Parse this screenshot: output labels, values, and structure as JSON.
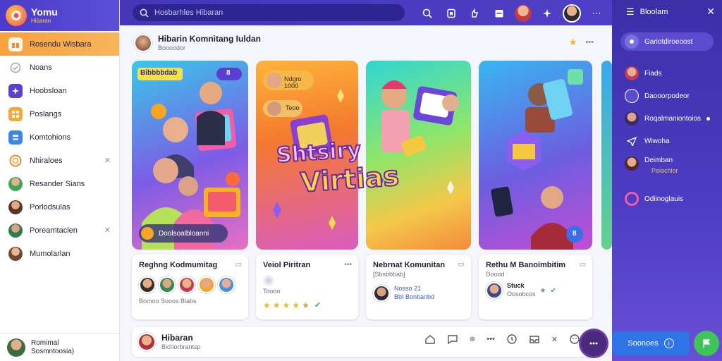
{
  "brand": {
    "name": "Yomu",
    "sub": "Hibaran"
  },
  "sidebar": {
    "items": [
      {
        "label": "Rosendu Wisbara",
        "icon": "gift-icon",
        "color": "#f6a23e",
        "active": true
      },
      {
        "label": "Noans",
        "icon": "check-circle-icon",
        "color": "#9aa0b3"
      },
      {
        "label": "Hoobsloan",
        "icon": "sparkle-icon",
        "color": "#5b3fd8"
      },
      {
        "label": "Poslangs",
        "icon": "grid-icon",
        "color": "#f7a63a"
      },
      {
        "label": "Komtohions",
        "icon": "layers-icon",
        "color": "#3a86ef"
      },
      {
        "label": "Nhiraloes",
        "icon": "swirl-icon",
        "color": "#f08a2e",
        "closable": true
      },
      {
        "label": "Resander Sians",
        "icon": "avatar-icon",
        "color": "#3aa858"
      },
      {
        "label": "Porlodsulas",
        "icon": "avatar-icon",
        "color": "#b0654a"
      },
      {
        "label": "Poreamtaclen",
        "icon": "avatar-icon",
        "color": "#3a9a6a",
        "closable": true
      },
      {
        "label": "Mumolarlan",
        "icon": "avatar-icon",
        "color": "#b68a62"
      }
    ],
    "footer": {
      "name": "Romimal",
      "sub": "Sosmntoosia)"
    }
  },
  "topbar": {
    "search_placeholder": "Hosbarhles Hibaran"
  },
  "header": {
    "title": "Hibarin Komnitang Iuldan",
    "subtitle": "Boooodor"
  },
  "banners": [
    {
      "badge": "Bibbbbdab",
      "count": "8",
      "chip": "Doolsoalbloanni"
    },
    {
      "chip_top": "Ndgro 1000",
      "chip_mid": "Teoo"
    },
    {
      "headline_1": "Shtsiry",
      "headline_2": "Virtias"
    },
    {
      "badge": "8"
    }
  ],
  "cards": [
    {
      "title": "Reghng Kodmumitag",
      "meta": "Bomoo Sooos Blabs"
    },
    {
      "title": "Veiol Piritran",
      "meta": "Toooo",
      "rating": 4.5
    },
    {
      "title": "Nebrnat Komunitan",
      "subtitle": "[Sbsbbbab]",
      "line1": "Nosso 21",
      "line2": "Bbt Bonbanbd"
    },
    {
      "title": "Rethu M Banoimbitim",
      "subtitle": "Doood",
      "line1": "Stuck",
      "line2": "Oosobcos"
    }
  ],
  "composer": {
    "title": "Hibaran",
    "subtitle": "Bichorbrantsp"
  },
  "rpanel": {
    "header": "Bloolam",
    "top": "Gariotdiroeoost",
    "items": [
      {
        "label": "Fiads",
        "icon": "avatar-icon"
      },
      {
        "label": "Daooorpodeor",
        "icon": "emoji-icon"
      },
      {
        "label": "Roqalmaniontoios",
        "icon": "avatar-icon"
      },
      {
        "label": "Wiwoha",
        "icon": "paper-plane-icon"
      },
      {
        "label": "Deimban",
        "sub": "Peiachlor",
        "icon": "avatar-icon"
      },
      {
        "label": "Odiinoglauis",
        "icon": "ring-icon"
      }
    ],
    "cta": "Soonoes"
  }
}
